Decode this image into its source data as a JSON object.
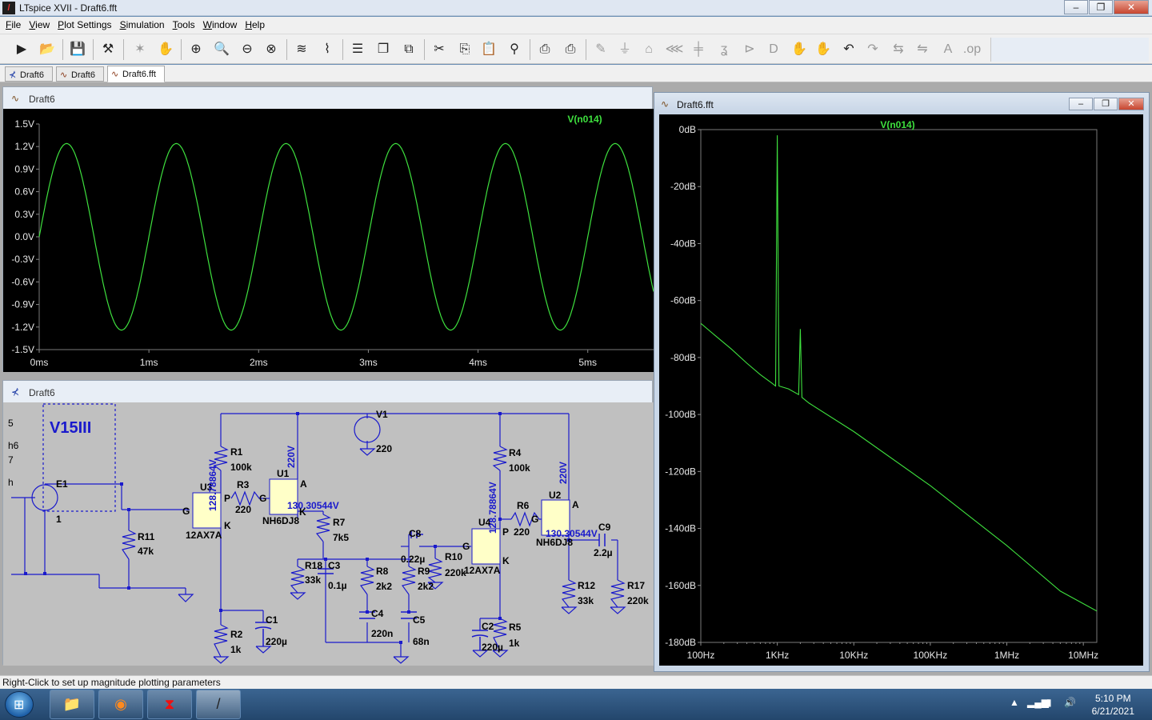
{
  "window": {
    "title": "LTspice XVII - Draft6.fft",
    "min": "–",
    "max": "❐",
    "close": "✕"
  },
  "menu": [
    "File",
    "View",
    "Plot Settings",
    "Simulation",
    "Tools",
    "Window",
    "Help"
  ],
  "tabs": [
    "Draft6",
    "Draft6",
    "Draft6.fft"
  ],
  "waveform_panel": {
    "title": "Draft6",
    "trace": "V(n014)"
  },
  "schematic_panel": {
    "title": "Draft6"
  },
  "fft_window": {
    "title": "Draft6.fft",
    "trace": "V(n014)"
  },
  "status": "Right-Click to set up magnitude plotting parameters",
  "clock": {
    "time": "5:10 PM",
    "date": "6/21/2021"
  },
  "chart_data": [
    {
      "type": "line",
      "title": "V(n014)",
      "xlabel": "",
      "ylabel": "",
      "x_ticks": [
        "0ms",
        "1ms",
        "2ms",
        "3ms",
        "4ms",
        "5ms"
      ],
      "y_ticks": [
        "1.5V",
        "1.2V",
        "0.9V",
        "0.6V",
        "0.3V",
        "0.0V",
        "-0.3V",
        "-0.6V",
        "-0.9V",
        "-1.2V",
        "-1.5V"
      ],
      "xlim": [
        0,
        5.6
      ],
      "ylim": [
        -1.5,
        1.5
      ],
      "series": [
        {
          "name": "V(n014)",
          "frequency_hz": 1000,
          "amplitude_v": 1.24,
          "peak_time_ms": 0.25,
          "color": "#3ee03e"
        }
      ]
    },
    {
      "type": "line",
      "title": "V(n014)",
      "xlabel": "",
      "ylabel": "",
      "x_scale": "log",
      "x_ticks": [
        "100Hz",
        "1KHz",
        "10KHz",
        "100KHz",
        "1MHz",
        "10MHz"
      ],
      "y_ticks": [
        "0dB",
        "-20dB",
        "-40dB",
        "-60dB",
        "-80dB",
        "-100dB",
        "-120dB",
        "-140dB",
        "-160dB",
        "-180dB"
      ],
      "xlim": [
        100,
        15000000
      ],
      "ylim": [
        -180,
        0
      ],
      "series": [
        {
          "name": "V(n014)",
          "color": "#3ee03e",
          "points": [
            [
              100,
              -68
            ],
            [
              150,
              -72
            ],
            [
              250,
              -77
            ],
            [
              400,
              -82
            ],
            [
              600,
              -86
            ],
            [
              850,
              -89
            ],
            [
              950,
              -90
            ],
            [
              1000,
              -2
            ],
            [
              1050,
              -90
            ],
            [
              1400,
              -91
            ],
            [
              1900,
              -93
            ],
            [
              2000,
              -70
            ],
            [
              2100,
              -94
            ],
            [
              2600,
              -96
            ],
            [
              10000,
              -106
            ],
            [
              100000,
              -125
            ],
            [
              1000000,
              -146
            ],
            [
              5000000,
              -162
            ],
            [
              15000000,
              -169
            ]
          ]
        }
      ]
    }
  ],
  "schematic": {
    "block_label": "V15III",
    "partial_labels": [
      "5",
      "h6",
      "7",
      "h"
    ],
    "components": {
      "E1": "E1",
      "E1_val": "1",
      "R11": "R11",
      "R11_val": "47k",
      "U3": "U3",
      "U3_type": "12AX7A",
      "U3_v": "128.78864V",
      "R1": "R1",
      "R1_val": "100k",
      "R3": "R3",
      "R3_val": "220",
      "U1": "U1",
      "U1_type": "NH6DJ8",
      "U1_v": "130.30544V",
      "U1_a": "220V",
      "V1": "V1",
      "V1_val": "220",
      "R7": "R7",
      "R7_val": "7k5",
      "R18": "R18",
      "R18_val": "33k",
      "C3": "C3",
      "C3_val": "0.1µ",
      "R8": "R8",
      "R8_val": "2k2",
      "C8": "C8",
      "C8_val": "0.22µ",
      "R9": "R9",
      "R9_val": "2k2",
      "R10": "R10",
      "R10_val": "220k",
      "C4": "C4",
      "C4_val": "220n",
      "C5": "C5",
      "C5_val": "68n",
      "R2": "R2",
      "R2_val": "1k",
      "C1": "C1",
      "C1_val": "220µ",
      "R4": "R4",
      "R4_val": "100k",
      "U4": "U4",
      "U4_type": "12AX7A",
      "U4_v": "128.78864V",
      "R6": "R6",
      "R6_val": "220",
      "U2": "U2",
      "U2_type": "NH6DJ8",
      "U2_v": "130.30544V",
      "U2_a": "220V",
      "C9": "C9",
      "C9_val": "2.2µ",
      "R12": "R12",
      "R12_val": "33k",
      "R17": "R17",
      "R17_val": "220k",
      "C2": "C2",
      "C2_val": "220µ",
      "R5": "R5",
      "R5_val": "1k"
    },
    "pins": {
      "G": "G",
      "P": "P",
      "K": "K",
      "A": "A"
    }
  }
}
